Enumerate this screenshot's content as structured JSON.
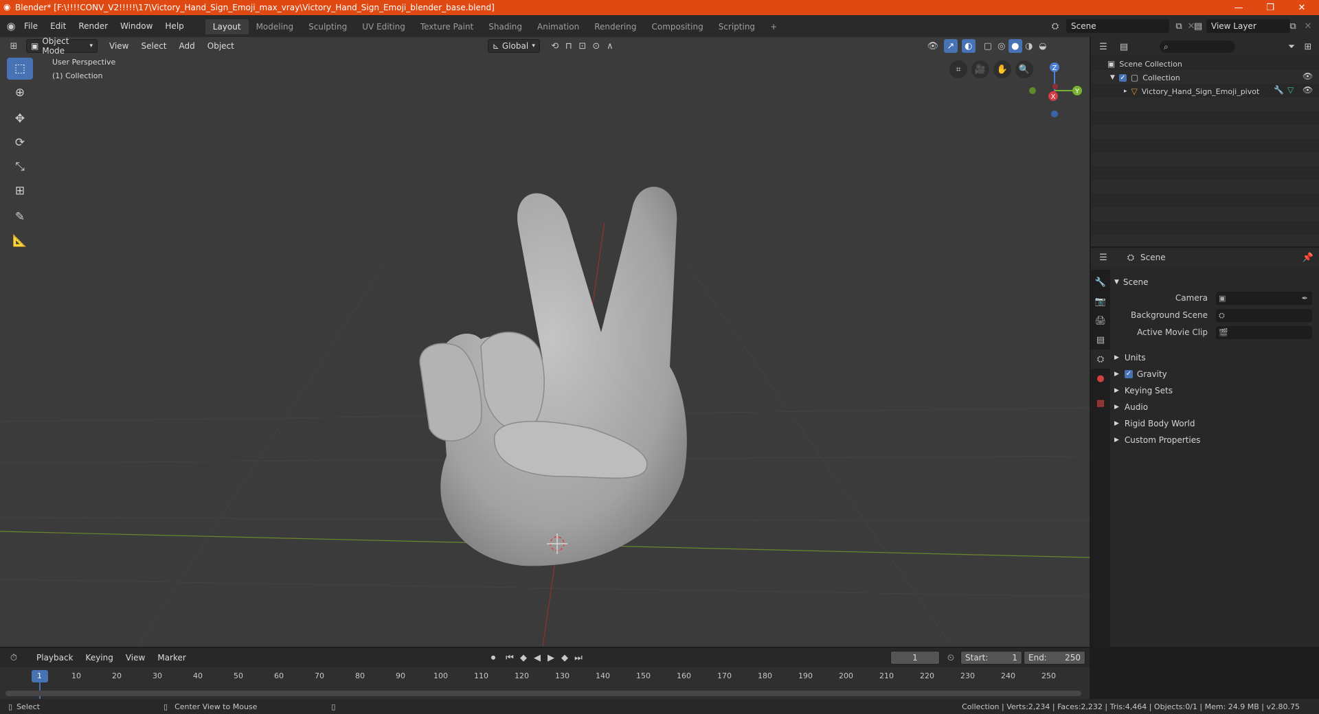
{
  "window": {
    "title": "Blender* [F:\\!!!!CONV_V2!!!!!\\17\\Victory_Hand_Sign_Emoji_max_vray\\Victory_Hand_Sign_Emoji_blender_base.blend]",
    "accent": "#e04a12"
  },
  "menu": {
    "items": [
      "File",
      "Edit",
      "Render",
      "Window",
      "Help"
    ]
  },
  "workspaces": {
    "tabs": [
      "Layout",
      "Modeling",
      "Sculpting",
      "UV Editing",
      "Texture Paint",
      "Shading",
      "Animation",
      "Rendering",
      "Compositing",
      "Scripting"
    ],
    "active": "Layout",
    "add_label": "+"
  },
  "scene_selector": {
    "value": "Scene"
  },
  "viewlayer_selector": {
    "value": "View Layer"
  },
  "viewport_header": {
    "mode": "Object Mode",
    "menus": [
      "View",
      "Select",
      "Add",
      "Object"
    ],
    "transform_orientation": "Global"
  },
  "viewport": {
    "perspective_label": "User Perspective",
    "collection_label": "(1) Collection",
    "gizmo_axes": {
      "z": "Z",
      "y": "Y",
      "x": "X"
    }
  },
  "outliner": {
    "root": "Scene Collection",
    "collection": "Collection",
    "object": "Victory_Hand_Sign_Emoji_pivot"
  },
  "properties": {
    "header_title": "Scene",
    "panel_title": "Scene",
    "fields": [
      {
        "label": "Camera"
      },
      {
        "label": "Background Scene"
      },
      {
        "label": "Active Movie Clip"
      }
    ],
    "sections": [
      "Units",
      "Gravity",
      "Keying Sets",
      "Audio",
      "Rigid Body World",
      "Custom Properties"
    ]
  },
  "timeline": {
    "menus": [
      "Playback",
      "Keying",
      "View",
      "Marker"
    ],
    "current_frame": "1",
    "start_label": "Start:",
    "start_value": "1",
    "end_label": "End:",
    "end_value": "250",
    "ruler": [
      "1",
      "10",
      "20",
      "30",
      "40",
      "50",
      "60",
      "70",
      "80",
      "90",
      "100",
      "110",
      "120",
      "130",
      "140",
      "150",
      "160",
      "170",
      "180",
      "190",
      "200",
      "210",
      "220",
      "230",
      "240",
      "250"
    ]
  },
  "statusbar": {
    "left_action": "Select",
    "mid_action": "Center View to Mouse",
    "stats": "Collection | Verts:2,234 | Faces:2,232 | Tris:4,464 | Objects:0/1 | Mem: 24.9 MB | v2.80.75"
  }
}
